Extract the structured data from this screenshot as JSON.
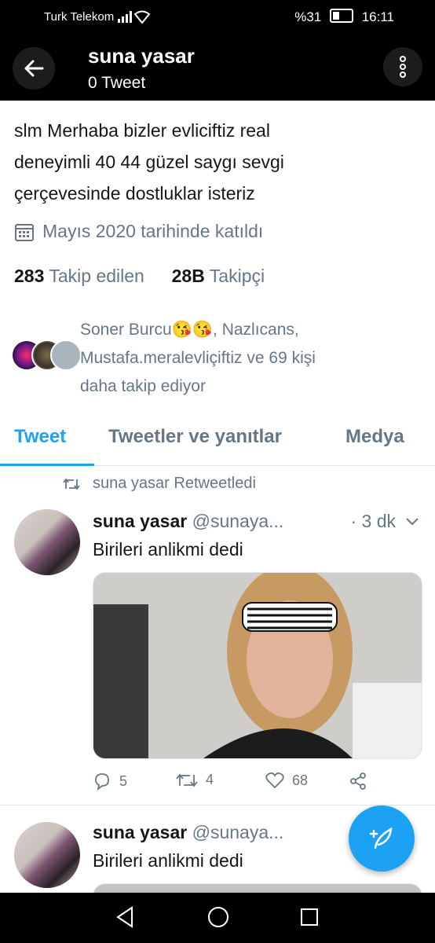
{
  "status": {
    "carrier": "Turk Telekom",
    "battery": "%31",
    "time": "16:11"
  },
  "header": {
    "name": "suna yasar",
    "tweet_count": "0 Tweet"
  },
  "profile": {
    "bio_line1": "slm Merhaba bizler evliciftiz real",
    "bio_line2": "deneyimli 40 44 güzel saygı sevgi",
    "bio_line3": "çerçevesinde dostluklar isteriz",
    "joined": "Mayıs 2020 tarihinde katıldı",
    "following_count": "283",
    "following_label": "Takip edilen",
    "followers_count": "28B",
    "followers_label": "Takipçi",
    "followed_by_line1": "Soner Burcu😘😘, Nazlıcans,",
    "followed_by_line2": "Mustafa.meralevliçiftiz ve 69 kişi",
    "followed_by_line3": "daha takip ediyor"
  },
  "tabs": [
    {
      "label": "Tweet"
    },
    {
      "label": "Tweetler ve yanıtlar"
    },
    {
      "label": "Medya"
    }
  ],
  "tweets": [
    {
      "retweet_label": "suna yasar Retweetledi",
      "author": "suna yasar",
      "handle": "@sunaya...",
      "time": "· 3 dk",
      "text": "Birileri anlikmi  dedi",
      "replies": "5",
      "retweets": "4",
      "likes": "68"
    },
    {
      "author": "suna yasar",
      "handle": "@sunaya...",
      "text": "Birileri anlikmi  dedi"
    }
  ],
  "colors": {
    "accent": "#1da1f2",
    "muted": "#657786",
    "text": "#14171a"
  }
}
